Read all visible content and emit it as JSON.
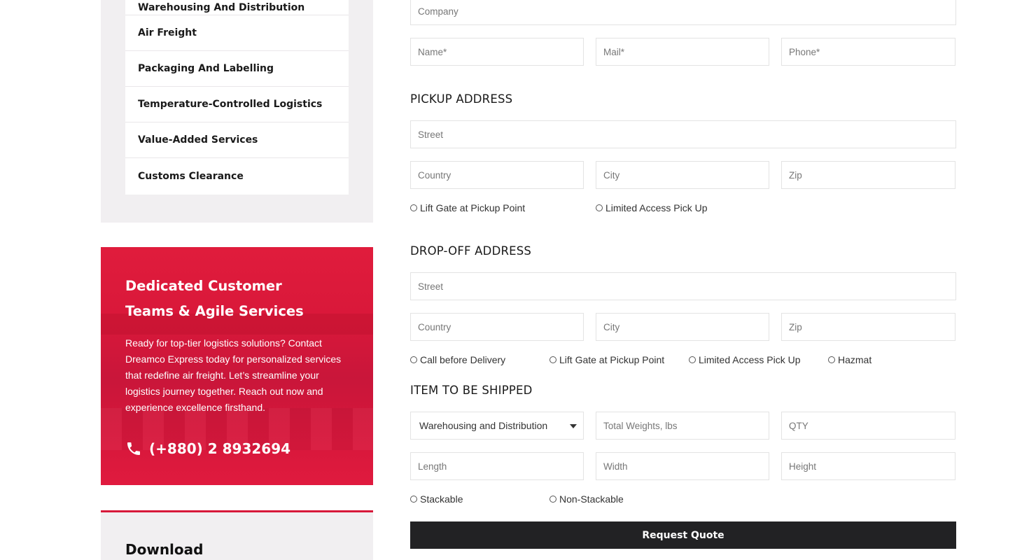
{
  "sidebar": {
    "services": [
      "Warehousing And Distribution",
      "Air Freight",
      "Packaging And Labelling",
      "Temperature-Controlled Logistics",
      "Value-Added Services",
      "Customs Clearance"
    ],
    "promo": {
      "title_line1": "Dedicated Customer",
      "title_line2": "Teams & Agile Services",
      "text": "Ready for top-tier logistics solutions? Contact Dreamco Express today for personalized services that redefine air freight. Let’s streamline your logistics journey together. Reach out now and experience excellence firsthand.",
      "phone": "(+880) 2 8932694",
      "phone_icon": "phone-icon"
    },
    "download_title": "Download"
  },
  "form": {
    "company_placeholder": "Company",
    "name_placeholder": "Name*",
    "mail_placeholder": "Mail*",
    "phone_placeholder": "Phone*",
    "pickup": {
      "heading": "PICKUP ADDRESS",
      "street_placeholder": "Street",
      "country_placeholder": "Country",
      "city_placeholder": "City",
      "zip_placeholder": "Zip",
      "options": [
        "Lift Gate at Pickup Point",
        "Limited Access Pick Up"
      ]
    },
    "dropoff": {
      "heading": "DROP-OFF ADDRESS",
      "street_placeholder": "Street",
      "country_placeholder": "Country",
      "city_placeholder": "City",
      "zip_placeholder": "Zip",
      "options": [
        "Call before Delivery",
        "Lift Gate at Pickup Point",
        "Limited Access Pick Up",
        "Hazmat"
      ]
    },
    "item": {
      "heading": "ITEM TO BE SHIPPED",
      "service_selected": "Warehousing and Distribution",
      "weight_placeholder": "Total Weights, lbs",
      "qty_placeholder": "QTY",
      "length_placeholder": "Length",
      "width_placeholder": "Width",
      "height_placeholder": "Height",
      "options": [
        "Stackable",
        "Non-Stackable"
      ]
    },
    "submit_label": "Request Quote"
  },
  "colors": {
    "accent": "#d7193a",
    "panel_bg": "#f1eff1",
    "button_bg": "#222224"
  }
}
